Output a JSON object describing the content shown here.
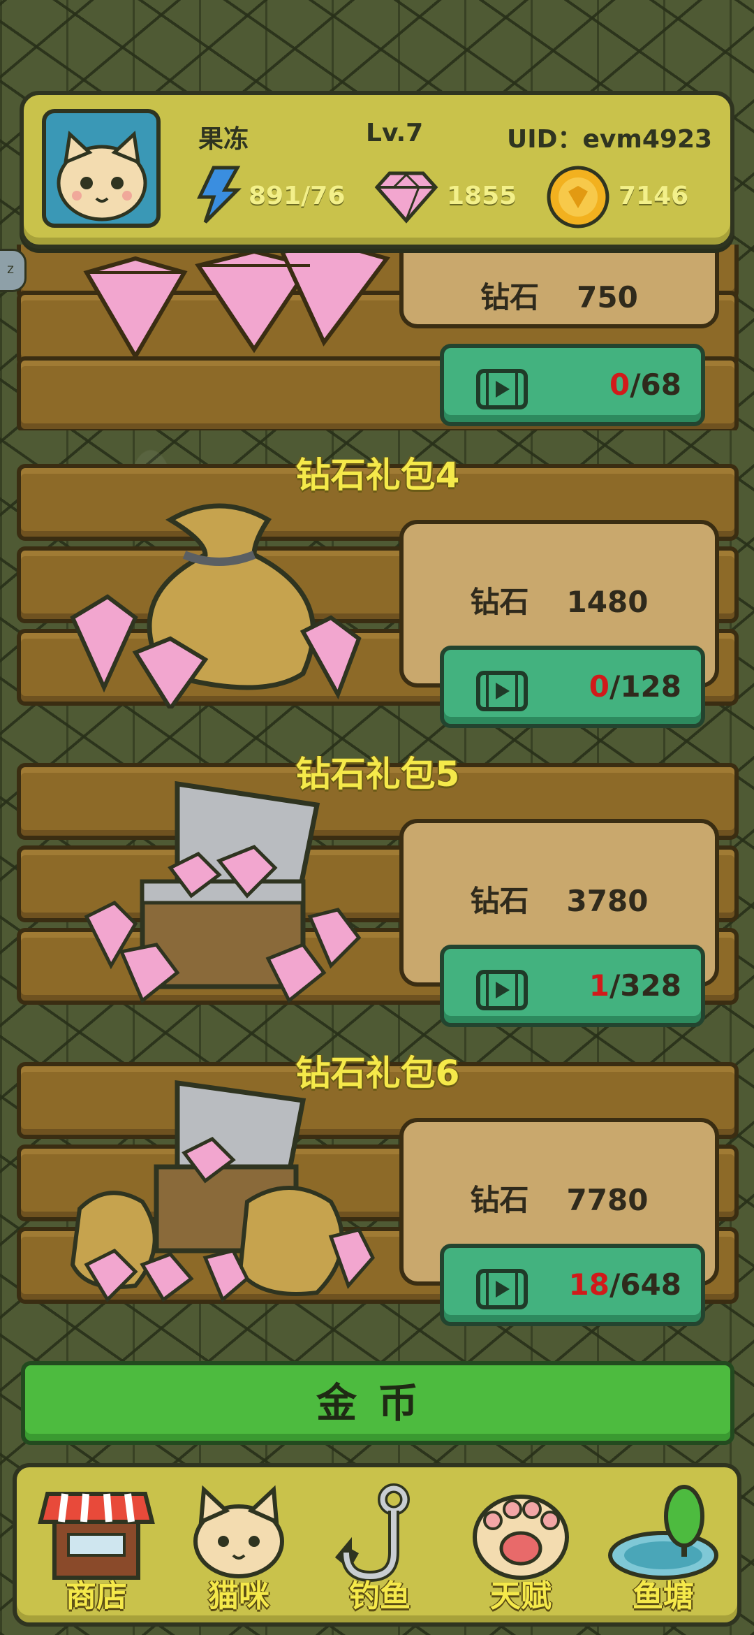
{
  "header": {
    "name": "果冻",
    "level": "Lv.7",
    "uid": "UID：evm4923",
    "energy": "891/76",
    "diamonds": "1855",
    "coins": "7146"
  },
  "packages": [
    {
      "title": "",
      "label": "钻石",
      "amount": "750",
      "ad_current": "0",
      "ad_total": "/68"
    },
    {
      "title": "钻石礼包4",
      "label": "钻石",
      "amount": "1480",
      "ad_current": "0",
      "ad_total": "/128"
    },
    {
      "title": "钻石礼包5",
      "label": "钻石",
      "amount": "3780",
      "ad_current": "1",
      "ad_total": "/328"
    },
    {
      "title": "钻石礼包6",
      "label": "钻石",
      "amount": "7780",
      "ad_current": "18",
      "ad_total": "/648"
    }
  ],
  "gold_button": "金币",
  "nav": [
    {
      "label": "商店",
      "icon": "shop-icon"
    },
    {
      "label": "猫咪",
      "icon": "cat-icon"
    },
    {
      "label": "钓鱼",
      "icon": "fishhook-icon"
    },
    {
      "label": "天赋",
      "icon": "paw-icon"
    },
    {
      "label": "鱼塘",
      "icon": "pond-icon"
    }
  ],
  "colors": {
    "accent_red": "#d11a1a",
    "button_green": "#43b27f",
    "title_yellow": "#f5e94a"
  }
}
